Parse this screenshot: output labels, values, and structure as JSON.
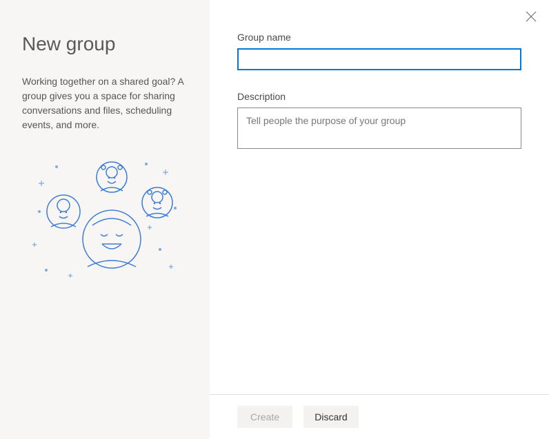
{
  "sidebar": {
    "title": "New group",
    "description": "Working together on a shared goal? A group gives you a space for sharing conversations and files, scheduling events, and more."
  },
  "form": {
    "group_name": {
      "label": "Group name",
      "value": ""
    },
    "description": {
      "label": "Description",
      "placeholder": "Tell people the purpose of your group",
      "value": ""
    }
  },
  "footer": {
    "create_label": "Create",
    "discard_label": "Discard"
  }
}
